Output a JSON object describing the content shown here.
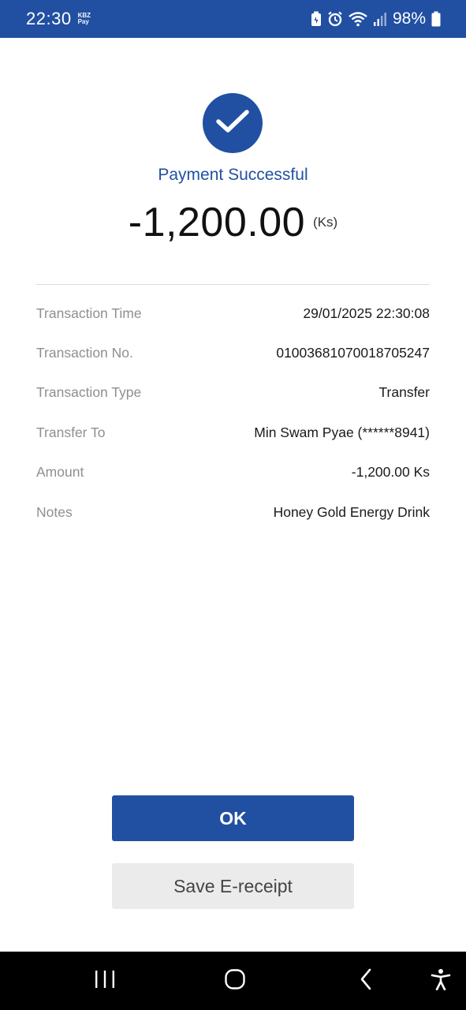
{
  "status_bar": {
    "time": "22:30",
    "app_badge_line1": "KBZ",
    "app_badge_line2": "Pay",
    "battery_percent": "98%",
    "icons": [
      "battery-saver-icon",
      "alarm-icon",
      "wifi-icon",
      "signal-icon",
      "battery-icon"
    ]
  },
  "result": {
    "icon": "check-icon",
    "title": "Payment Successful",
    "amount": "-1,200.00",
    "currency": "(Ks)"
  },
  "details": [
    {
      "label": "Transaction Time",
      "value": "29/01/2025 22:30:08"
    },
    {
      "label": "Transaction No.",
      "value": "01003681070018705247"
    },
    {
      "label": "Transaction Type",
      "value": "Transfer"
    },
    {
      "label": "Transfer To",
      "value": "Min Swam Pyae (******8941)"
    },
    {
      "label": "Amount",
      "value": "-1,200.00 Ks"
    },
    {
      "label": "Notes",
      "value": "Honey Gold Energy Drink"
    }
  ],
  "actions": {
    "ok_label": "OK",
    "save_label": "Save E-receipt"
  },
  "nav_bar": {
    "icons": [
      "recent-apps-icon",
      "home-icon",
      "back-icon",
      "accessibility-icon"
    ]
  },
  "colors": {
    "brand": "#2150a2",
    "secondary_button": "#ebebeb",
    "label_text": "#8f8f8f"
  }
}
